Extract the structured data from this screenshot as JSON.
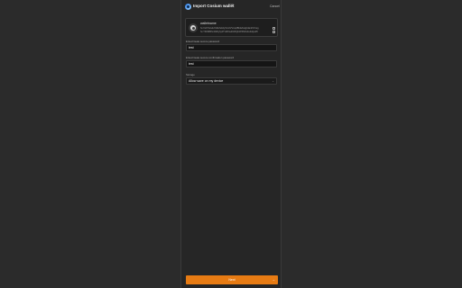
{
  "header": {
    "title": "Import Cosium wallet",
    "badge": "JS",
    "cancel_label": "Cancel"
  },
  "wallet": {
    "name": "walletname",
    "address_1": "hx  hVcHsrsdvXdfwhdrdyXsmfVVxsplBfdwfsdgzsEnKfVssg",
    "address_2": "hx  T3Fl8fRhn4MhyhybTvWKwd04XQbJP4Mrls0u4ofjsuHI",
    "icon": "wallet-avatar-icon"
  },
  "fields": {
    "password_label": "Enter/create secure password",
    "password_value": "test",
    "confirm_label": "Enter/create secure confirmation password",
    "confirm_value": "test",
    "storage_label": "Storage",
    "storage_value": "Allow save on my device"
  },
  "footer": {
    "button_label": "Next",
    "arrow": "→"
  },
  "colors": {
    "accent": "#e77b13",
    "background": "#2b2b2b",
    "panel": "#262626"
  }
}
